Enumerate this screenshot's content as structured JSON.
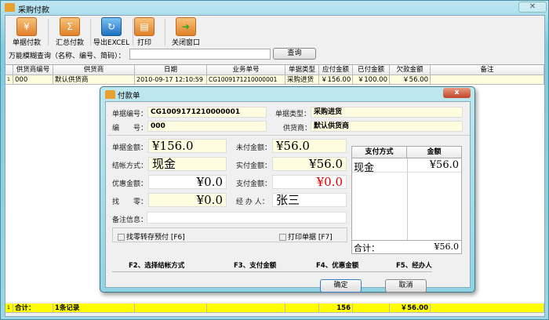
{
  "window": {
    "title": "采购付款",
    "close": "✕"
  },
  "toolbar": [
    {
      "label": "单据付款",
      "icon": "payment-icon"
    },
    {
      "label": "汇总付款",
      "icon": "summary-icon"
    },
    {
      "label": "导出EXCEL",
      "icon": "excel-export-icon"
    },
    {
      "label": "打印",
      "icon": "printer-icon"
    },
    {
      "label": "关闭窗口",
      "icon": "exit-icon"
    }
  ],
  "search": {
    "label": "万能模糊查询（名称、编号、简码）：",
    "value": "",
    "button": "查询"
  },
  "table": {
    "columns": [
      "供货商编号",
      "供货商",
      "日期",
      "业务单号",
      "单据类型",
      "应付金额",
      "已付金额",
      "欠款金额",
      "备注"
    ],
    "rows": [
      {
        "num": "1",
        "cells": [
          "000",
          "默认供货商",
          "2010-09-17 12:10:59",
          "CG1009171210000001",
          "采购进货",
          "￥156.00",
          "￥100.00",
          "￥56.00",
          ""
        ]
      }
    ],
    "footer": {
      "num": "1",
      "label": "合计：",
      "count": "1条记录",
      "payable": "156",
      "owed": "￥56.00"
    }
  },
  "dialog": {
    "title": "付款单",
    "close": "x",
    "bill_no_label": "单据编号：",
    "bill_no": "CG1009171210000001",
    "bill_type_label": "单据类型：",
    "bill_type": "采购进货",
    "code_label": "编　　号：",
    "code": "000",
    "supplier_label": "供货商：",
    "supplier": "默认供货商",
    "amount_label": "单据金额：",
    "amount": "¥156.0",
    "unpaid_label": "未付金额：",
    "unpaid": "¥56.0",
    "method_label": "结帐方式：",
    "method": "现金",
    "actual_label": "实付金额：",
    "actual": "¥56.0",
    "discount_label": "优惠金额：",
    "discount": "¥0.0",
    "pay_label": "支付金额：",
    "pay": "¥0.0",
    "change_label": "找　　零：",
    "change": "¥0.0",
    "handler_label": "经 办 人：",
    "handler": "张三",
    "note_label": "备注信息：",
    "note": "",
    "pay_table": {
      "headers": [
        "支付方式",
        "金额"
      ],
      "rows": [
        [
          "现金",
          "¥56.0"
        ]
      ],
      "total_label": "合计：",
      "total": "¥56.0"
    },
    "check_change": "找零转存预付 [F6]",
    "check_print": "打印单据 [F7]",
    "hotkeys": [
      "F2、选择结帐方式",
      "F3、支付金额",
      "F4、优惠金额",
      "F5、经办人"
    ],
    "ok": "确定",
    "cancel": "取消",
    "colors": {
      "pay_amount": "#e00000",
      "field_bg": "#fffde0",
      "footer": "#ffff00"
    }
  }
}
